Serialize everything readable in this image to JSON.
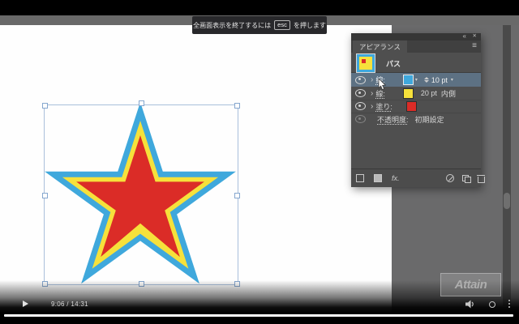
{
  "player": {
    "tooltip": {
      "prefix": "全画面表示を終了するには",
      "key": "esc",
      "suffix": "を押します"
    },
    "time": "9:06 / 14:31",
    "watermark": "Attain"
  },
  "panel": {
    "tab_label": "アピアランス",
    "collapse_glyph": "«",
    "close_glyph": "✕",
    "menu_glyph": "≡",
    "item_label": "パス",
    "stroke1": {
      "label": "線:",
      "weight": "10 pt"
    },
    "stroke2": {
      "label": "線:",
      "weight": "20 pt",
      "align": "内側"
    },
    "fill": {
      "label": "塗り:"
    },
    "opacity": {
      "label": "不透明度:",
      "value": "初期設定"
    },
    "fx_label": "fx."
  },
  "glyphs": {
    "disclosure": "›",
    "dropdown": "▾"
  },
  "colors": {
    "stroke1_blue": "#3FA8DC",
    "stroke2_yellow": "#F6E13B",
    "fill_red": "#DB2C27",
    "selected_row": "#5d7183"
  }
}
